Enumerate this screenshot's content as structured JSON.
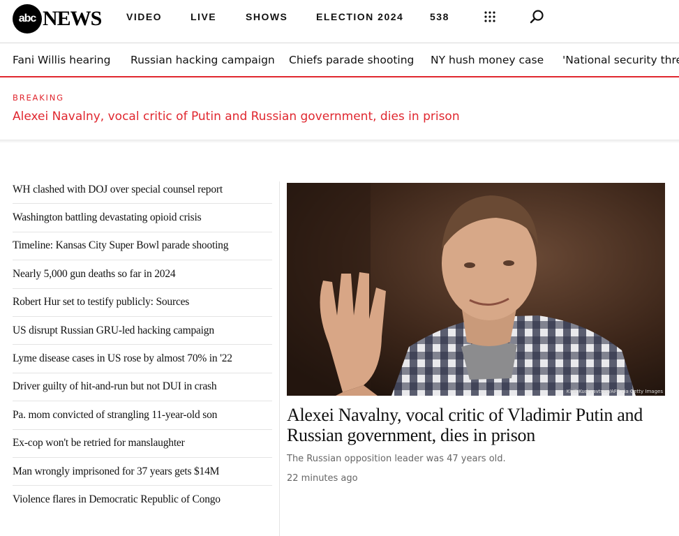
{
  "header": {
    "logo_badge": "abc",
    "logo_word": "NEWS",
    "nav": [
      "VIDEO",
      "LIVE",
      "SHOWS",
      "ELECTION 2024",
      "538"
    ],
    "icons": [
      "grid-menu-icon",
      "search-icon"
    ]
  },
  "trending": [
    "Fani Willis hearing",
    "Russian hacking campaign",
    "Chiefs parade shooting",
    "NY hush money case",
    "'National security threat"
  ],
  "breaking": {
    "label": "BREAKING",
    "headline": "Alexei Navalny, vocal critic of Putin and Russian government, dies in prison"
  },
  "headlines": [
    "WH clashed with DOJ over special counsel report",
    "Washington battling devastating opioid crisis",
    "Timeline: Kansas City Super Bowl parade shooting",
    "Nearly 5,000 gun deaths so far in 2024",
    "Robert Hur set to testify publicly: Sources",
    "US disrupt Russian GRU-led hacking campaign",
    "Lyme disease cases in US rose by almost 70% in '22",
    "Driver guilty of hit-and-run but not DUI in crash",
    "Pa. mom convicted of strangling 11-year-old son",
    "Ex-cop won't be retried for manslaughter",
    "Man wrongly imprisoned for 37 years gets $14M",
    "Violence flares in Democratic Republic of Congo"
  ],
  "lead": {
    "photo_credit": "Kirill Kudryavtsev/AFP via Getty Images",
    "title": "Alexei Navalny, vocal critic of Vladimir Putin and Russian government, dies in prison",
    "summary": "The Russian opposition leader was 47 years old.",
    "time": "22 minutes ago"
  },
  "colors": {
    "accent_red": "#e0272f",
    "text": "#111111",
    "muted": "#666666"
  }
}
